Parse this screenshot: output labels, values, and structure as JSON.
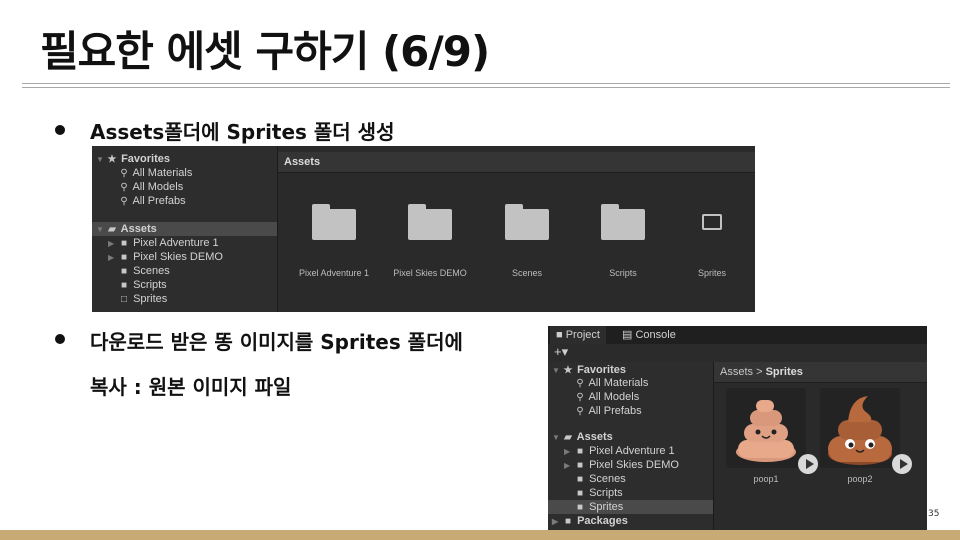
{
  "slide": {
    "title": "필요한 에셋 구하기 (6/9)",
    "bullet1": "Assets폴더에 Sprites 폴더 생성",
    "bullet2_line1": "다운로드 받은 똥 이미지를 Sprites 폴더에",
    "bullet2_line2": "복사 : 원본 이미지 파일",
    "page_number": "35",
    "accent_color": "#c7aa74"
  },
  "panel1": {
    "tree": {
      "favorites": "Favorites",
      "favorite_items": [
        "All Materials",
        "All Models",
        "All Prefabs"
      ],
      "assets": "Assets",
      "asset_items": [
        "Pixel Adventure 1",
        "Pixel Skies DEMO",
        "Scenes",
        "Scripts",
        "Sprites"
      ]
    },
    "breadcrumb": "Assets",
    "grid_items": [
      "Pixel Adventure 1",
      "Pixel Skies DEMO",
      "Scenes",
      "Scripts",
      "Sprites"
    ]
  },
  "panel2": {
    "tabs": [
      "Project",
      "Console"
    ],
    "toolbar": "+▾",
    "tree": {
      "favorites": "Favorites",
      "favorite_items": [
        "All Materials",
        "All Models",
        "All Prefabs"
      ],
      "assets": "Assets",
      "asset_items": [
        "Pixel Adventure 1",
        "Pixel Skies DEMO",
        "Scenes",
        "Scripts",
        "Sprites"
      ],
      "packages": "Packages"
    },
    "breadcrumb_root": "Assets",
    "breadcrumb_sep": ">",
    "breadcrumb_leaf": "Sprites",
    "grid_items": [
      "poop1",
      "poop2"
    ]
  }
}
